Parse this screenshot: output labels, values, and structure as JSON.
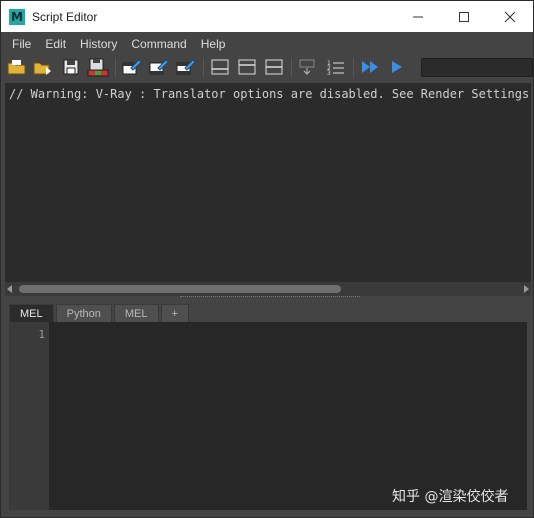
{
  "window": {
    "app_icon_letter": "M",
    "title": "Script Editor",
    "controls": [
      "minimize",
      "maximize",
      "close"
    ]
  },
  "menu": {
    "items": [
      "File",
      "Edit",
      "History",
      "Command",
      "Help"
    ]
  },
  "toolbar": {
    "icons": [
      "open-script-icon",
      "source-script-icon",
      "save-script-icon",
      "save-script-to-shelf-icon",
      "clear-history-icon",
      "clear-input-icon",
      "clear-all-icon",
      "show-history-only-icon",
      "show-input-only-icon",
      "show-both-icon",
      "echo-all-commands-icon",
      "show-line-numbers-icon",
      "execute-all-icon",
      "execute-icon"
    ],
    "accent_color": "#3a8ee6"
  },
  "output": {
    "lines": [
      "// Warning: V-Ray : Translator options are disabled. See Render Settings > V-Ray > Translator"
    ]
  },
  "tabs": {
    "items": [
      "MEL",
      "Python",
      "MEL",
      "+"
    ],
    "active_index": 0
  },
  "input": {
    "line_numbers": [
      "1"
    ],
    "content": ""
  },
  "watermark": {
    "text": "知乎 @渲染佼佼者"
  }
}
